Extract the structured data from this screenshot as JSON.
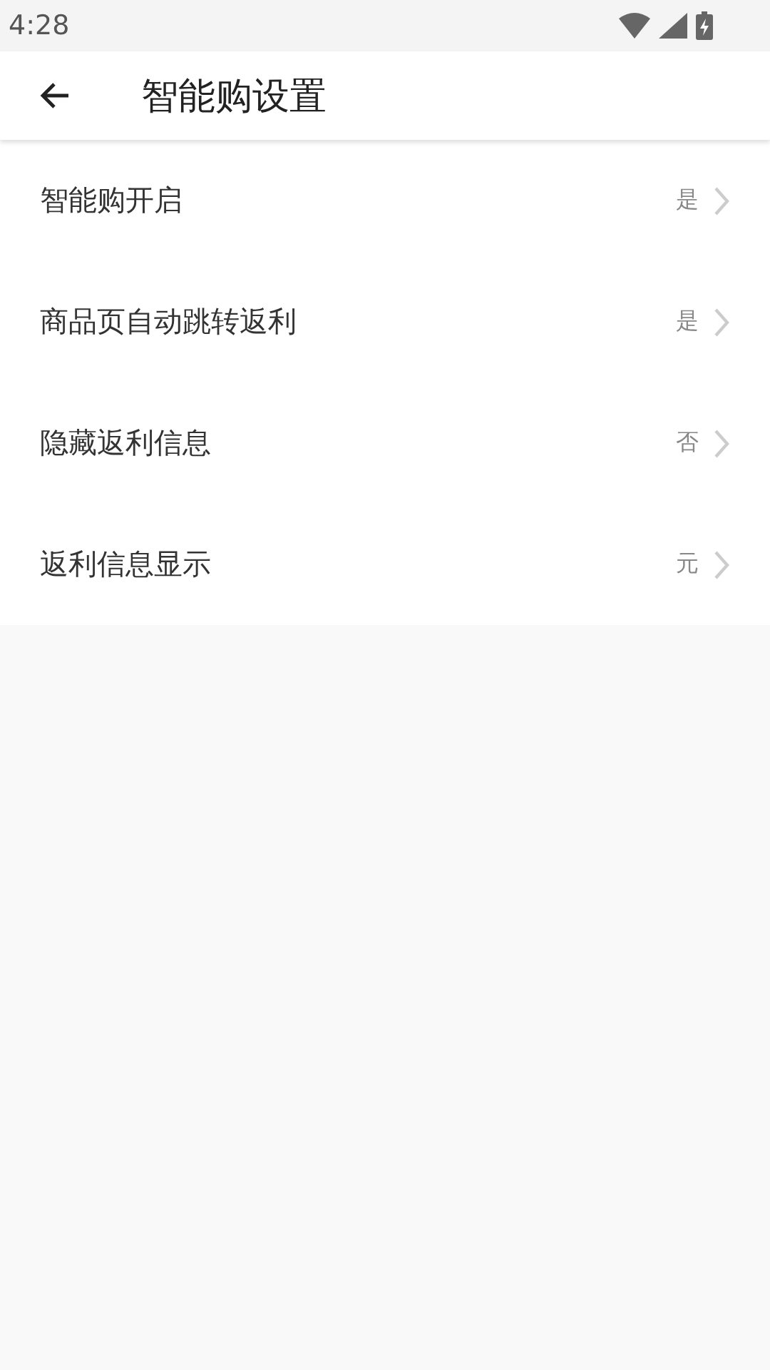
{
  "status_bar": {
    "time": "4:28"
  },
  "header": {
    "title": "智能购设置"
  },
  "settings": [
    {
      "label": "智能购开启",
      "value": "是"
    },
    {
      "label": "商品页自动跳转返利",
      "value": "是"
    },
    {
      "label": "隐藏返利信息",
      "value": "否"
    },
    {
      "label": "返利信息显示",
      "value": "元"
    }
  ]
}
